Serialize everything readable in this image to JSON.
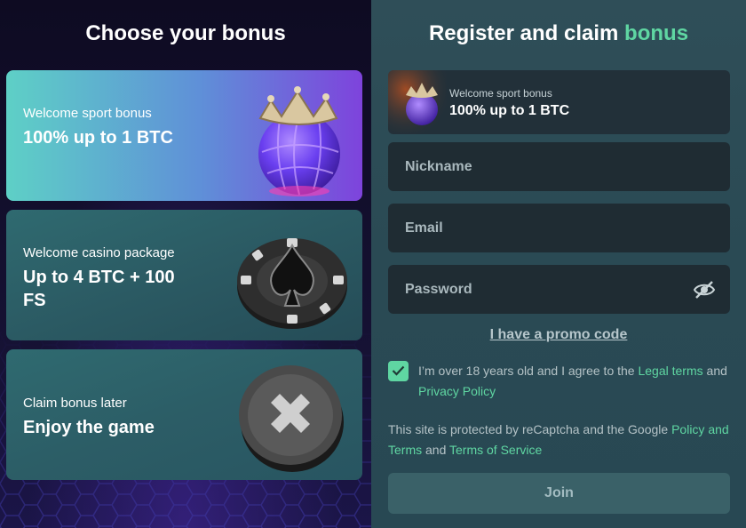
{
  "left": {
    "title": "Choose your bonus",
    "cards": [
      {
        "subtitle": "Welcome sport bonus",
        "main": "100% up to 1 BTC",
        "icon": "crowned-ball-icon"
      },
      {
        "subtitle": "Welcome casino package",
        "main": "Up to 4 BTC + 100 FS",
        "icon": "poker-chip-spade-icon"
      },
      {
        "subtitle": "Claim bonus later",
        "main": "Enjoy the game",
        "icon": "x-coin-icon"
      }
    ]
  },
  "right": {
    "title_main": "Register and claim",
    "title_accent": "bonus",
    "selected_bonus": {
      "subtitle": "Welcome sport bonus",
      "main": "100% up to 1 BTC"
    },
    "fields": {
      "nickname_placeholder": "Nickname",
      "email_placeholder": "Email",
      "password_placeholder": "Password"
    },
    "promo_link": "I have a promo code",
    "agree": {
      "prefix": "I’m over 18 years old and I agree to the ",
      "legal": "Legal terms",
      "and": " and ",
      "privacy": "Privacy Policy",
      "checked": true
    },
    "recaptcha": {
      "prefix": "This site is protected by reCaptcha and the Google ",
      "policy": "Policy and Terms",
      "and": " and ",
      "terms": "Terms of Service"
    },
    "join_label": "Join"
  },
  "colors": {
    "accent": "#5fd6a2",
    "right_bg": "#2f4e58",
    "field_bg": "#1f2c33",
    "join_bg": "#3a6168"
  }
}
